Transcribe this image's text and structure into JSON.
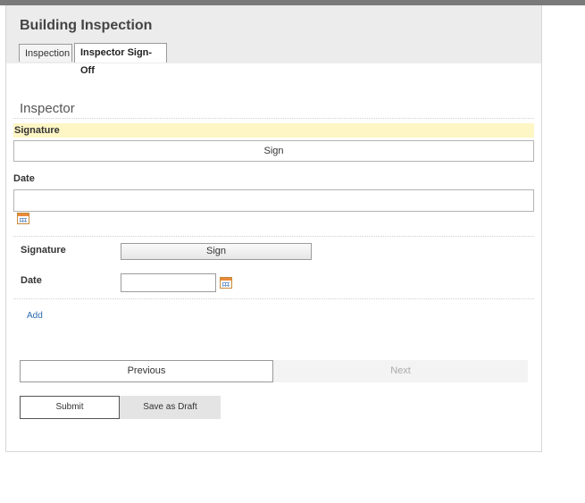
{
  "form": {
    "title": "Building Inspection",
    "tabs": [
      {
        "label": "Inspection",
        "active": false
      },
      {
        "label": "Inspector Sign-Off",
        "active": true
      }
    ]
  },
  "inspector_section": {
    "heading": "Inspector",
    "signature_label": "Signature",
    "signature_button": "Sign",
    "date_label": "Date",
    "date_value": ""
  },
  "repeat_row": {
    "signature_label": "Signature",
    "signature_button": "Sign",
    "date_label": "Date",
    "date_value": ""
  },
  "add_link": "Add",
  "navigation": {
    "previous_label": "Previous",
    "next_label": "Next"
  },
  "actions": {
    "submit_label": "Submit",
    "save_draft_label": "Save as Draft"
  },
  "colors": {
    "highlight": "#fef6c4",
    "header_bg": "#ececec",
    "link": "#2a6ab0"
  },
  "icons": [
    "calendar-icon"
  ]
}
